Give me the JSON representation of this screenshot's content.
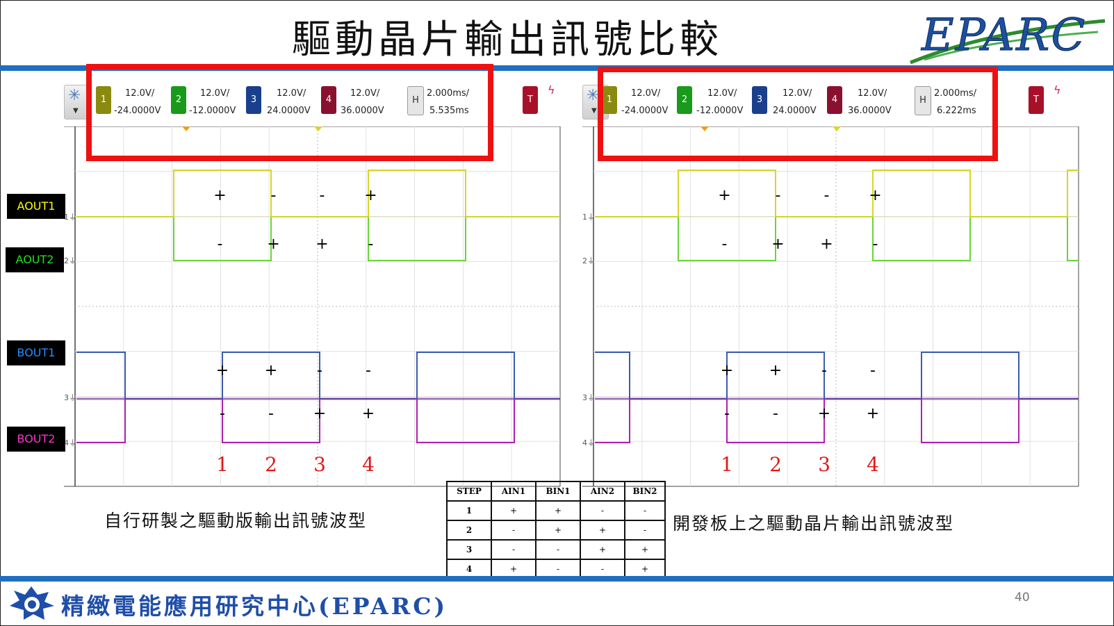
{
  "title": "驅動晶片輸出訊號比較",
  "logo_text": "EPARC",
  "left_scope": {
    "channels": [
      {
        "num": "1",
        "scale": "12.0V/",
        "offset": "-24.0000V",
        "color": "#8a8a10"
      },
      {
        "num": "2",
        "scale": "12.0V/",
        "offset": "-12.0000V",
        "color": "#1a9a1a"
      },
      {
        "num": "3",
        "scale": "12.0V/",
        "offset": "24.0000V",
        "color": "#1a3f8c"
      },
      {
        "num": "4",
        "scale": "12.0V/",
        "offset": "36.0000V",
        "color": "#8a1030"
      }
    ],
    "horizontal": {
      "tag": "H",
      "scale": "2.000ms/",
      "delay": "5.535ms"
    },
    "trigger": {
      "tag": "T"
    },
    "steps": [
      {
        "aout1": "+",
        "aout2": "-",
        "bout1": "+",
        "bout2": "-",
        "label": "1"
      },
      {
        "aout1": "-",
        "aout2": "+",
        "bout1": "+",
        "bout2": "-",
        "label": "2"
      },
      {
        "aout1": "-",
        "aout2": "+",
        "bout1": "-",
        "bout2": "+",
        "label": "3"
      },
      {
        "aout1": "+",
        "aout2": "-",
        "bout1": "-",
        "bout2": "+",
        "label": "4"
      }
    ]
  },
  "right_scope": {
    "channels": [
      {
        "num": "1",
        "scale": "12.0V/",
        "offset": "-24.0000V",
        "color": "#8a8a10"
      },
      {
        "num": "2",
        "scale": "12.0V/",
        "offset": "-12.0000V",
        "color": "#1a9a1a"
      },
      {
        "num": "3",
        "scale": "12.0V/",
        "offset": "24.0000V",
        "color": "#1a3f8c"
      },
      {
        "num": "4",
        "scale": "12.0V/",
        "offset": "36.0000V",
        "color": "#8a1030"
      }
    ],
    "horizontal": {
      "tag": "H",
      "scale": "2.000ms/",
      "delay": "6.222ms"
    },
    "trigger": {
      "tag": "T"
    },
    "steps": [
      {
        "aout1": "+",
        "aout2": "-",
        "bout1": "+",
        "bout2": "-",
        "label": "1"
      },
      {
        "aout1": "-",
        "aout2": "+",
        "bout1": "+",
        "bout2": "-",
        "label": "2"
      },
      {
        "aout1": "-",
        "aout2": "+",
        "bout1": "-",
        "bout2": "+",
        "label": "3"
      },
      {
        "aout1": "+",
        "aout2": "-",
        "bout1": "-",
        "bout2": "+",
        "label": "4"
      }
    ]
  },
  "signal_labels": [
    {
      "text": "AOUT1",
      "color": "#ffff00"
    },
    {
      "text": "AOUT2",
      "color": "#22dd22"
    },
    {
      "text": "BOUT1",
      "color": "#1e90ff"
    },
    {
      "text": "BOUT2",
      "color": "#ff33cc"
    }
  ],
  "trace_colors": {
    "aout1": "#d6d62a",
    "aout2": "#6bd33a",
    "bout1": "#3a5bb0",
    "bout2": "#b020b0"
  },
  "captions": {
    "left": "自行研製之驅動版輸出訊號波型",
    "right": "開發板上之驅動晶片輸出訊號波型"
  },
  "table": {
    "headers": [
      "STEP",
      "AIN1",
      "BIN1",
      "AIN2",
      "BIN2"
    ],
    "rows": [
      [
        "1",
        "+",
        "+",
        "-",
        "-"
      ],
      [
        "2",
        "-",
        "+",
        "+",
        "-"
      ],
      [
        "3",
        "-",
        "-",
        "+",
        "+"
      ],
      [
        "4",
        "+",
        "-",
        "-",
        "+"
      ]
    ]
  },
  "footer": {
    "org": "精緻電能應用研究中心(EPARC)",
    "page": "40"
  }
}
